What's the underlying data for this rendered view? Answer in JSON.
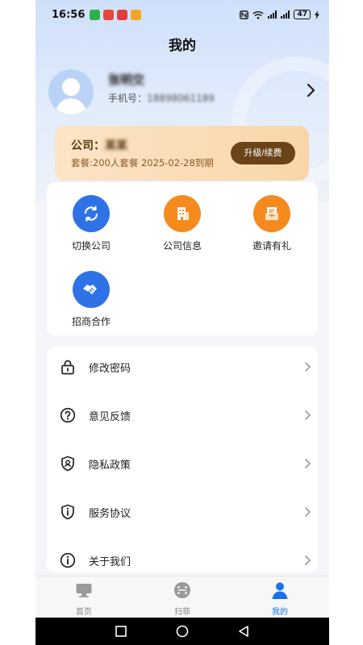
{
  "status_bar": {
    "time": "16:56",
    "battery": "47"
  },
  "page": {
    "title": "我的"
  },
  "profile": {
    "name": "张明交",
    "phone_label": "手机号：",
    "phone_value": "18898061189"
  },
  "vip": {
    "company_label": "公司：",
    "company_value": "某某",
    "plan": "套餐:200人套餐 2025-02-28到期",
    "button": "升级/续费"
  },
  "features": [
    {
      "label": "切换公司",
      "icon": "switch-icon"
    },
    {
      "label": "公司信息",
      "icon": "building-icon"
    },
    {
      "label": "邀请有礼",
      "icon": "gift-mail-icon"
    },
    {
      "label": "招商合作",
      "icon": "handshake-icon"
    }
  ],
  "menu": [
    {
      "label": "修改密码",
      "icon": "lock-icon"
    },
    {
      "label": "意见反馈",
      "icon": "help-icon"
    },
    {
      "label": "隐私政策",
      "icon": "shield-user-icon"
    },
    {
      "label": "服务协议",
      "icon": "shield-info-icon"
    },
    {
      "label": "关于我们",
      "icon": "info-icon"
    }
  ],
  "tabs": [
    {
      "label": "首页",
      "icon": "monitor-icon"
    },
    {
      "label": "扫菲",
      "icon": "scan-icon"
    },
    {
      "label": "我的",
      "icon": "person-icon"
    }
  ],
  "colors": {
    "accent": "#2f72e6",
    "orange": "#f58a1f",
    "vip_button": "#6b4318",
    "tab_active": "#1a73e8"
  }
}
